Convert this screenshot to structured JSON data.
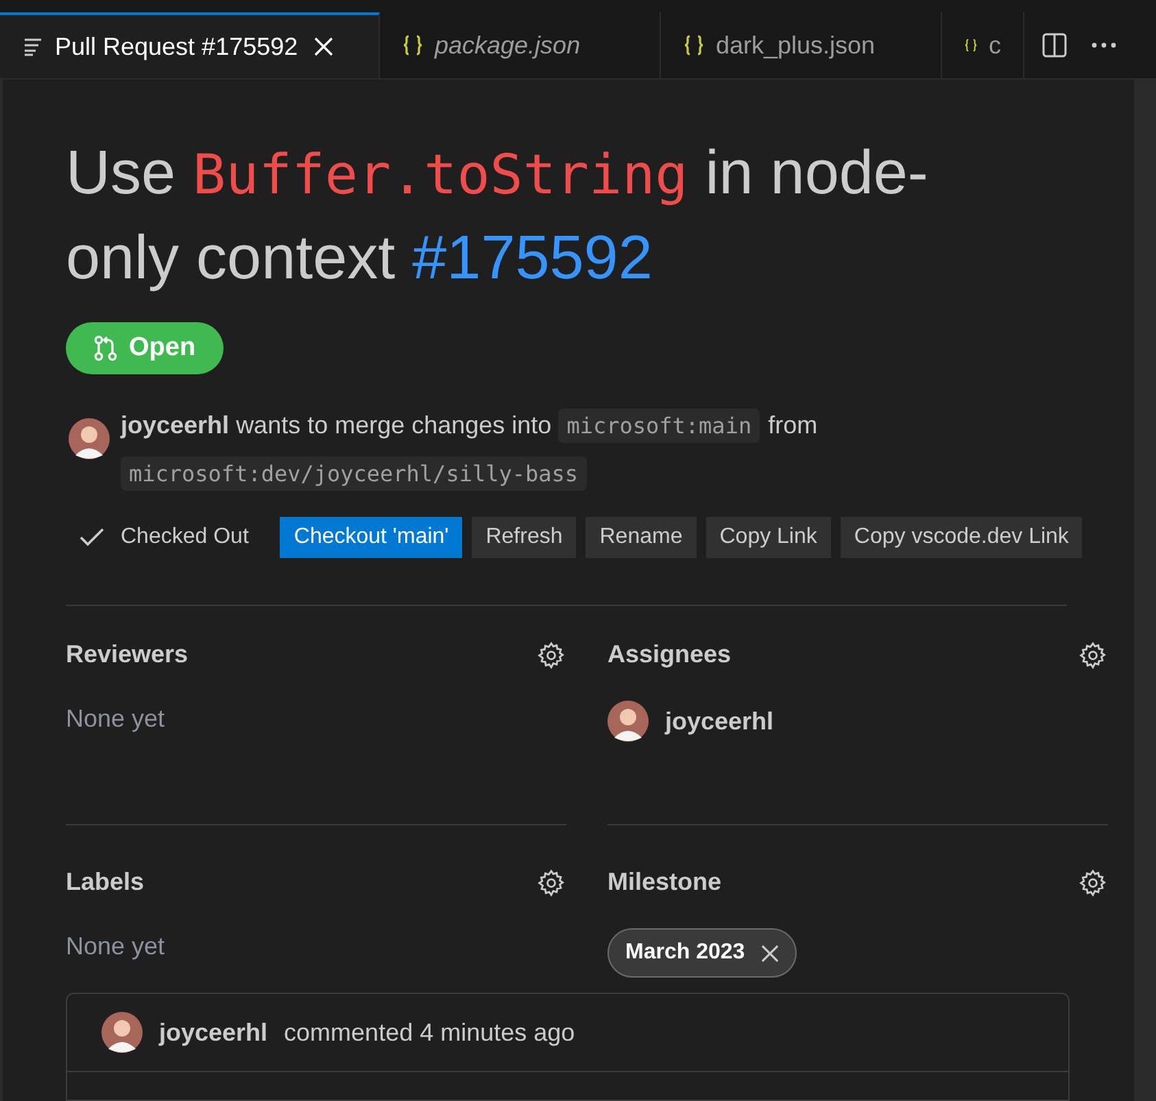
{
  "tabs": [
    {
      "label": "Pull Request #175592",
      "kind": "pr",
      "selected": true,
      "preview": false
    },
    {
      "label": "package.json",
      "kind": "json",
      "selected": false,
      "preview": true
    },
    {
      "label": "dark_plus.json",
      "kind": "json",
      "selected": false,
      "preview": false
    },
    {
      "label": "c",
      "kind": "json",
      "selected": false,
      "preview": false
    }
  ],
  "title": [
    {
      "kind": "text",
      "text": "Use "
    },
    {
      "kind": "code",
      "text": "Buffer.toString"
    },
    {
      "kind": "text",
      "text": " in node-only context "
    },
    {
      "kind": "number",
      "text": "#175592"
    }
  ],
  "status": {
    "label": "Open",
    "open": true
  },
  "merge_info": [
    {
      "kind": "author",
      "text": "joyceerhl"
    },
    {
      "kind": "text",
      "text": "wants to merge changes into"
    },
    {
      "kind": "code",
      "text": "microsoft:main"
    },
    {
      "kind": "text",
      "text": "from"
    },
    {
      "kind": "code",
      "text": "microsoft:dev/joyceerhl/silly-bass"
    }
  ],
  "actions": [
    {
      "kind": "status",
      "label": "Checked Out"
    },
    {
      "kind": "primary",
      "label": "Checkout 'main'"
    },
    {
      "kind": "secondary",
      "label": "Refresh"
    },
    {
      "kind": "secondary",
      "label": "Rename"
    },
    {
      "kind": "secondary",
      "label": "Copy Link"
    },
    {
      "kind": "secondary",
      "label": "Copy vscode.dev Link"
    }
  ],
  "sections": [
    {
      "title": "Reviewers",
      "kind": "empty",
      "text": "None yet"
    },
    {
      "title": "Assignees",
      "kind": "user",
      "text": "joyceerhl"
    },
    {
      "title": "Labels",
      "kind": "empty",
      "text": "None yet"
    },
    {
      "title": "Milestone",
      "kind": "chip",
      "text": "March 2023"
    }
  ],
  "comment": {
    "author": "joyceerhl",
    "meta": "commented 4 minutes ago"
  }
}
